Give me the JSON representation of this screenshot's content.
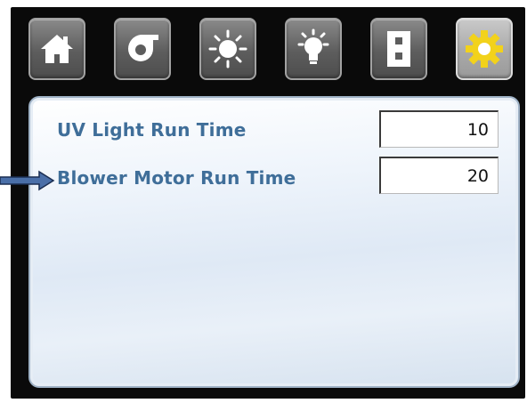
{
  "toolbar": {
    "buttons": [
      {
        "icon": "home-icon",
        "active": false
      },
      {
        "icon": "blower-icon",
        "active": false
      },
      {
        "icon": "uv-light-icon",
        "active": false
      },
      {
        "icon": "light-bulb-icon",
        "active": false
      },
      {
        "icon": "switch-icon",
        "active": false
      },
      {
        "icon": "gear-icon",
        "active": true
      }
    ]
  },
  "settings": {
    "uv_light_run_time": {
      "label": "UV Light Run Time",
      "value": "10"
    },
    "blower_motor_run_time": {
      "label": "Blower Motor Run Time",
      "value": "20"
    }
  },
  "colors": {
    "label": "#3f6e99",
    "gear_active": "#f2d21b",
    "icon_white": "#ffffff",
    "pointer_arrow": "#4a6fa8"
  }
}
